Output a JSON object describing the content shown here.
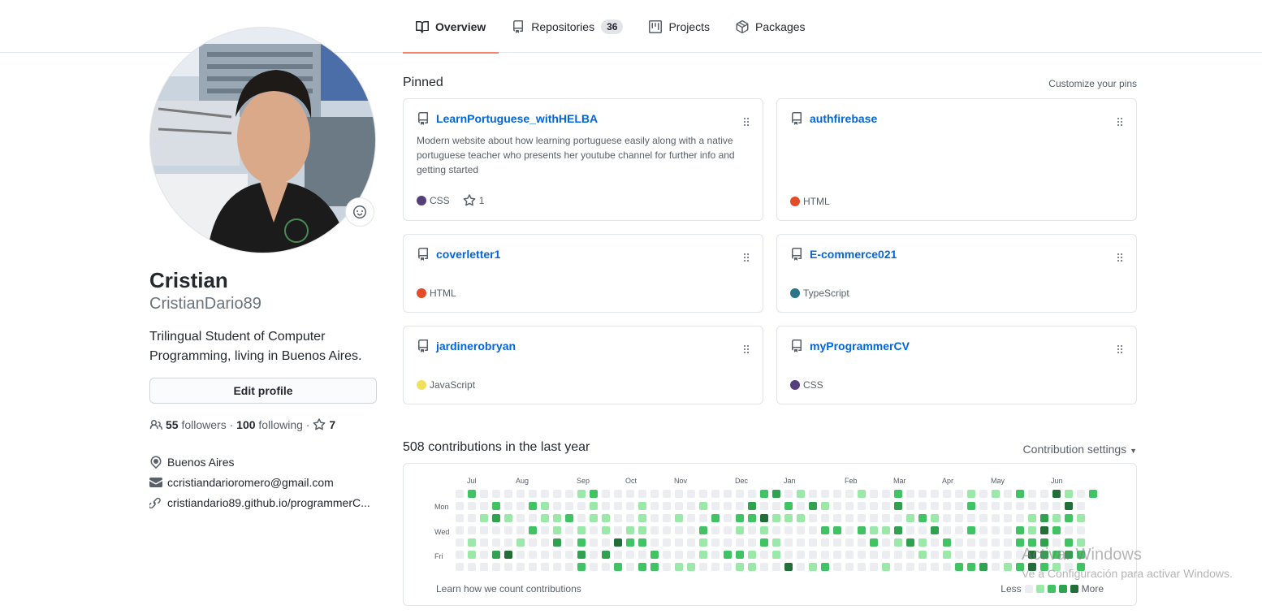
{
  "tabs": [
    {
      "label": "Overview",
      "icon": "book-icon",
      "selected": true
    },
    {
      "label": "Repositories",
      "icon": "repo-icon",
      "count": "36"
    },
    {
      "label": "Projects",
      "icon": "project-icon"
    },
    {
      "label": "Packages",
      "icon": "package-icon"
    }
  ],
  "profile": {
    "name": "Cristian",
    "username": "CristianDario89",
    "bio": "Trilingual Student of Computer Programming, living in Buenos Aires.",
    "edit_label": "Edit profile",
    "followers_count": "55",
    "followers_label": "followers",
    "following_count": "100",
    "following_label": "following",
    "stars_count": "7",
    "location": "Buenos Aires",
    "email": "ccristiandarioromero@gmail.com",
    "website": "cristiandario89.github.io/programmerC..."
  },
  "pinned": {
    "title": "Pinned",
    "customize_label": "Customize your pins",
    "repos": [
      {
        "name": "LearnPortuguese_withHELBA",
        "description": "Modern website about how learning portuguese easily along with a native portuguese teacher who presents her youtube channel for further info and getting started",
        "language": "CSS",
        "lang_color": "#563d7c",
        "stars": "1"
      },
      {
        "name": "authfirebase",
        "description": "",
        "language": "HTML",
        "lang_color": "#e34c26"
      },
      {
        "name": "coverletter1",
        "description": "",
        "language": "HTML",
        "lang_color": "#e34c26"
      },
      {
        "name": "E-commerce021",
        "description": "",
        "language": "TypeScript",
        "lang_color": "#2b7489"
      },
      {
        "name": "jardinerobryan",
        "description": "",
        "language": "JavaScript",
        "lang_color": "#f1e05a"
      },
      {
        "name": "myProgrammerCV",
        "description": "",
        "language": "CSS",
        "lang_color": "#563d7c"
      }
    ]
  },
  "contributions": {
    "title": "508 contributions in the last year",
    "settings_label": "Contribution settings",
    "months": [
      "Jul",
      "Aug",
      "Sep",
      "Oct",
      "Nov",
      "Dec",
      "Jan",
      "Feb",
      "Mar",
      "Apr",
      "May",
      "Jun"
    ],
    "day_labels": [
      "Mon",
      "Wed",
      "Fri"
    ],
    "learn_label": "Learn how we count contributions",
    "legend_less": "Less",
    "legend_more": "More",
    "colors": [
      "#ebedf0",
      "#9be9a8",
      "#40c463",
      "#30a14e",
      "#216e39"
    ]
  },
  "watermark": {
    "line1": "Activar Windows",
    "line2": "Ve a Configuración para activar Windows."
  }
}
